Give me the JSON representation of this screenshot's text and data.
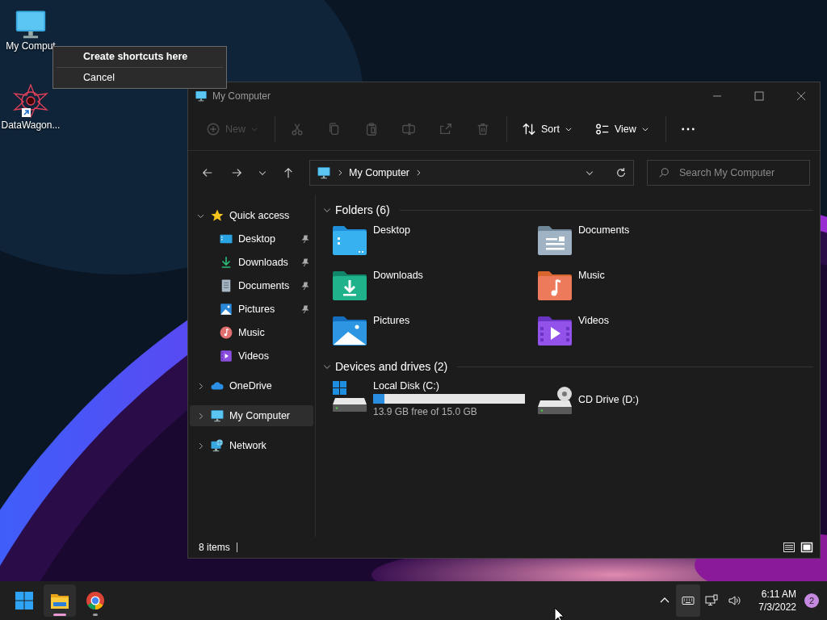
{
  "desktop_icons": [
    {
      "kind": "computer",
      "label": "My Comput"
    },
    {
      "kind": "app",
      "label": "DataWagon..."
    }
  ],
  "context_menu": {
    "items": [
      {
        "label": "Create shortcuts here",
        "default": true
      },
      {
        "label": "Cancel",
        "default": false
      }
    ]
  },
  "window": {
    "title": "My Computer",
    "toolbar": [
      {
        "kind": "new",
        "label": "New",
        "disabled": true
      },
      {
        "kind": "cut",
        "disabled": true
      },
      {
        "kind": "copy",
        "disabled": true
      },
      {
        "kind": "paste",
        "disabled": true
      },
      {
        "kind": "rename",
        "disabled": true
      },
      {
        "kind": "share",
        "disabled": true
      },
      {
        "kind": "delete",
        "disabled": true
      },
      {
        "kind": "sort",
        "label": "Sort",
        "disabled": false
      },
      {
        "kind": "view",
        "label": "View",
        "disabled": false
      },
      {
        "kind": "more",
        "disabled": false
      }
    ],
    "address": {
      "path": [
        "My Computer"
      ]
    },
    "search": {
      "placeholder": "Search My Computer"
    },
    "sidebar": [
      {
        "label": "Quick access",
        "kind": "star",
        "expanded": true,
        "selected": false,
        "children": [
          {
            "label": "Desktop",
            "kind": "desktop",
            "pinned": true,
            "selected": false
          },
          {
            "label": "Downloads",
            "kind": "downloads",
            "pinned": true,
            "selected": false
          },
          {
            "label": "Documents",
            "kind": "documents",
            "pinned": true,
            "selected": false
          },
          {
            "label": "Pictures",
            "kind": "pictures",
            "pinned": true,
            "selected": false
          },
          {
            "label": "Music",
            "kind": "music",
            "pinned": false,
            "selected": false
          },
          {
            "label": "Videos",
            "kind": "videos",
            "pinned": false,
            "selected": false
          }
        ]
      },
      {
        "label": "OneDrive",
        "kind": "cloud",
        "expanded": false,
        "selected": false
      },
      {
        "label": "My Computer",
        "kind": "computer",
        "expanded": false,
        "selected": true
      },
      {
        "label": "Network",
        "kind": "network",
        "expanded": false,
        "selected": false
      }
    ],
    "sections": [
      {
        "title": "Folders (6)",
        "expanded": true,
        "items": [
          {
            "name": "Desktop",
            "kind": "desktop"
          },
          {
            "name": "Documents",
            "kind": "documents"
          },
          {
            "name": "Downloads",
            "kind": "downloads"
          },
          {
            "name": "Music",
            "kind": "music"
          },
          {
            "name": "Pictures",
            "kind": "pictures"
          },
          {
            "name": "Videos",
            "kind": "videos"
          }
        ]
      },
      {
        "title": "Devices and drives (2)",
        "expanded": true,
        "items": [
          {
            "name": "Local Disk (C:)",
            "kind": "local",
            "level": 0.073,
            "detail": "13.9 GB free of 15.0 GB"
          },
          {
            "name": "CD Drive (D:)",
            "kind": "cd"
          }
        ]
      }
    ],
    "status_bar": {
      "count": "8 items"
    }
  },
  "taskbar": {
    "apps": [
      {
        "kind": "start",
        "active": false,
        "running": false
      },
      {
        "kind": "explorer",
        "active": true,
        "running": true
      },
      {
        "kind": "browser",
        "active": false,
        "running": true
      }
    ],
    "tray": [
      {
        "kind": "chevron",
        "highlighted": false
      },
      {
        "kind": "keyboard",
        "highlighted": true
      },
      {
        "kind": "network",
        "highlighted": false
      },
      {
        "kind": "volume",
        "highlighted": false
      }
    ],
    "time": "6:11 AM",
    "date": "7/3/2022",
    "notifications": "2"
  }
}
